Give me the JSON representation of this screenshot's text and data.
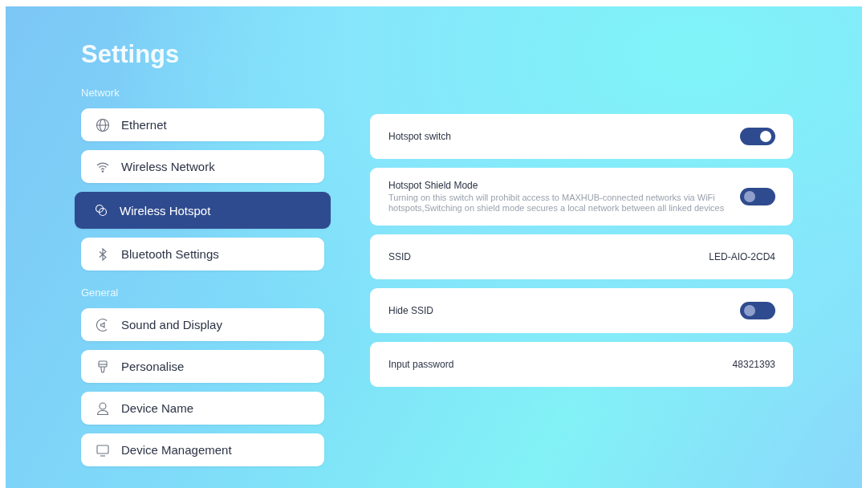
{
  "title": "Settings",
  "sections": [
    {
      "label": "Network",
      "items": [
        {
          "label": "Ethernet",
          "selected": false
        },
        {
          "label": "Wireless Network",
          "selected": false
        },
        {
          "label": "Wireless Hotspot",
          "selected": true
        },
        {
          "label": "Bluetooth Settings",
          "selected": false
        }
      ]
    },
    {
      "label": "General",
      "items": [
        {
          "label": "Sound and Display",
          "selected": false
        },
        {
          "label": "Personalise",
          "selected": false
        },
        {
          "label": "Device Name",
          "selected": false
        },
        {
          "label": "Device Management",
          "selected": false
        }
      ]
    }
  ],
  "rows": [
    {
      "kind": "switch",
      "label": "Hotspot switch",
      "on": true
    },
    {
      "kind": "switch",
      "label": "Hotspot Shield Mode",
      "description": "Turning on this switch will prohibit access to MAXHUB-connected networks via WiFi hotspots,Switching on shield mode secures a local network between all linked devices",
      "on": false
    },
    {
      "kind": "value",
      "label": "SSID",
      "value": "LED-AIO-2CD4"
    },
    {
      "kind": "switch",
      "label": "Hide SSID",
      "on": false
    },
    {
      "kind": "value",
      "label": "Input password",
      "value": "48321393"
    }
  ]
}
